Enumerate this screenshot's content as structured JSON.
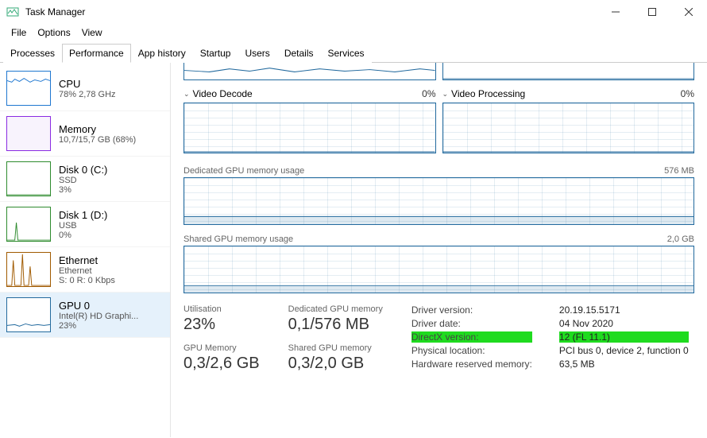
{
  "window": {
    "title": "Task Manager"
  },
  "menu": {
    "file": "File",
    "options": "Options",
    "view": "View"
  },
  "tabs": [
    {
      "label": "Processes"
    },
    {
      "label": "Performance",
      "active": true
    },
    {
      "label": "App history"
    },
    {
      "label": "Startup"
    },
    {
      "label": "Users"
    },
    {
      "label": "Details"
    },
    {
      "label": "Services"
    }
  ],
  "sidebar": [
    {
      "name": "CPU",
      "sub": "78% 2,78 GHz",
      "sub2": "",
      "color": "#1f77d0"
    },
    {
      "name": "Memory",
      "sub": "10,7/15,7 GB (68%)",
      "sub2": "",
      "color": "#8a2be2"
    },
    {
      "name": "Disk 0 (C:)",
      "sub": "SSD",
      "sub2": "3%",
      "color": "#2e8b2e"
    },
    {
      "name": "Disk 1 (D:)",
      "sub": "USB",
      "sub2": "0%",
      "color": "#2e8b2e"
    },
    {
      "name": "Ethernet",
      "sub": "Ethernet",
      "sub2": "S: 0 R: 0 Kbps",
      "color": "#a05a00"
    },
    {
      "name": "GPU 0",
      "sub": "Intel(R) HD Graphi...",
      "sub2": "23%",
      "color": "#236a9e"
    }
  ],
  "sections": {
    "video_decode": {
      "label": "Video Decode",
      "value": "0%"
    },
    "video_process": {
      "label": "Video Processing",
      "value": "0%"
    },
    "dedicated_mem": {
      "label": "Dedicated GPU memory usage",
      "value": "576 MB"
    },
    "shared_mem": {
      "label": "Shared GPU memory usage",
      "value": "2,0 GB"
    }
  },
  "stats": {
    "utilisation": {
      "label": "Utilisation",
      "value": "23%"
    },
    "dedicated": {
      "label": "Dedicated GPU memory",
      "value": "0,1/576 MB"
    },
    "gpu_memory": {
      "label": "GPU Memory",
      "value": "0,3/2,6 GB"
    },
    "shared": {
      "label": "Shared GPU memory",
      "value": "0,3/2,0 GB"
    }
  },
  "info": {
    "driver_version": {
      "k": "Driver version:",
      "v": "20.19.15.5171"
    },
    "driver_date": {
      "k": "Driver date:",
      "v": "04 Nov 2020"
    },
    "directx": {
      "k": "DirectX version:",
      "v": "12 (FL 11.1)"
    },
    "location": {
      "k": "Physical location:",
      "v": "PCI bus 0, device 2, function 0"
    },
    "reserved": {
      "k": "Hardware reserved memory:",
      "v": "63,5 MB"
    }
  },
  "chart_data": [
    {
      "type": "line",
      "title": "3D (partial, cropped)",
      "x": [],
      "y": [],
      "ylim": [
        0,
        100
      ]
    },
    {
      "type": "line",
      "title": "Copy (partial, cropped)",
      "x": [],
      "y": [],
      "ylim": [
        0,
        100
      ]
    },
    {
      "type": "line",
      "title": "Video Decode",
      "ylabel": "%",
      "ylim": [
        0,
        100
      ],
      "x": [
        0,
        1,
        2,
        3,
        4,
        5,
        6,
        7,
        8,
        9
      ],
      "y": [
        0,
        0,
        0,
        0,
        0,
        0,
        0,
        0,
        0,
        0
      ]
    },
    {
      "type": "line",
      "title": "Video Processing",
      "ylabel": "%",
      "ylim": [
        0,
        100
      ],
      "x": [
        0,
        1,
        2,
        3,
        4,
        5,
        6,
        7,
        8,
        9
      ],
      "y": [
        0,
        0,
        0,
        0,
        0,
        0,
        0,
        0,
        0,
        0
      ]
    },
    {
      "type": "line",
      "title": "Dedicated GPU memory usage",
      "ylabel": "MB",
      "ylim": [
        0,
        576
      ],
      "x": [
        0,
        1,
        2,
        3,
        4,
        5,
        6,
        7,
        8,
        9
      ],
      "y": [
        100,
        100,
        100,
        100,
        100,
        100,
        100,
        100,
        100,
        100
      ]
    },
    {
      "type": "line",
      "title": "Shared GPU memory usage",
      "ylabel": "GB",
      "ylim": [
        0,
        2.0
      ],
      "x": [
        0,
        1,
        2,
        3,
        4,
        5,
        6,
        7,
        8,
        9
      ],
      "y": [
        0.3,
        0.3,
        0.3,
        0.3,
        0.3,
        0.3,
        0.3,
        0.3,
        0.3,
        0.3
      ]
    }
  ]
}
